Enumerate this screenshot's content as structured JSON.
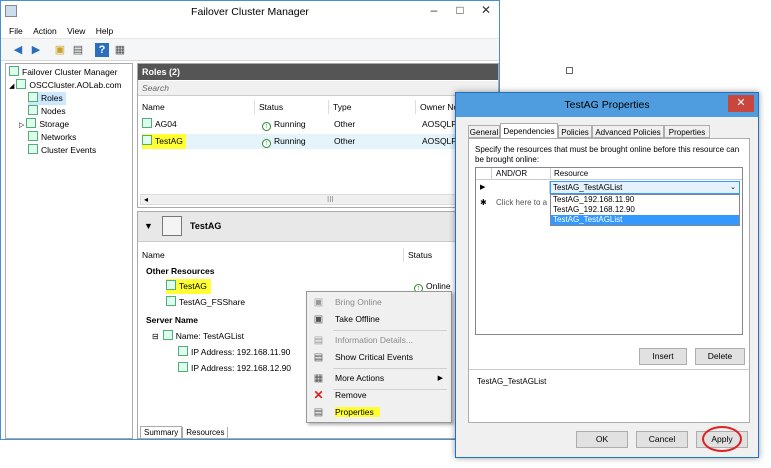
{
  "main_window": {
    "title": "Failover Cluster Manager",
    "menu": [
      "File",
      "Action",
      "View",
      "Help"
    ]
  },
  "tree": {
    "root": "Failover Cluster Manager",
    "cluster": "OSCCluster.AOLab.com",
    "items": [
      "Roles",
      "Nodes",
      "Storage",
      "Networks",
      "Cluster Events"
    ]
  },
  "roles": {
    "header": "Roles (2)",
    "search_placeholder": "Search",
    "columns": [
      "Name",
      "Status",
      "Type",
      "Owner No"
    ],
    "rows": [
      {
        "name": "AG04",
        "status": "Running",
        "type": "Other",
        "owner": "AOSQLP"
      },
      {
        "name": "TestAG",
        "status": "Running",
        "type": "Other",
        "owner": "AOSQLP"
      }
    ],
    "scroll_glyph": "III"
  },
  "detail": {
    "title": "TestAG",
    "columns": [
      "Name",
      "Status"
    ],
    "other_resources_label": "Other Resources",
    "resources": [
      {
        "name": "TestAG",
        "status": "Online"
      },
      {
        "name": "TestAG_FSShare",
        "status": ""
      }
    ],
    "server_name_label": "Server Name",
    "server_entry": "Name: TestAGList",
    "ip_addresses": [
      "IP Address: 192.168.11.90",
      "IP Address: 192.168.12.90"
    ],
    "tabs": [
      "Summary",
      "Resources"
    ]
  },
  "context_menu": {
    "items": [
      {
        "label": "Bring Online",
        "enabled": false
      },
      {
        "label": "Take Offline",
        "enabled": true
      },
      {
        "label": "Information Details...",
        "enabled": false
      },
      {
        "label": "Show Critical Events",
        "enabled": true
      },
      {
        "label": "More Actions",
        "enabled": true
      },
      {
        "label": "Remove",
        "enabled": true
      },
      {
        "label": "Properties",
        "enabled": true
      }
    ]
  },
  "dialog": {
    "title": "TestAG Properties",
    "tabs": [
      "General",
      "Dependencies",
      "Policies",
      "Advanced Policies",
      "Properties"
    ],
    "active_tab": "Dependencies",
    "instruction": "Specify the resources that must be brought online before this resource can be brought online:",
    "grid_columns": [
      "AND/OR",
      "Resource"
    ],
    "selected_value": "TestAG_TestAGList",
    "new_row_placeholder": "Click here to a",
    "dropdown_options": [
      "TestAG_192.168.11.90",
      "TestAG_192.168.12.90",
      "TestAG_TestAGList"
    ],
    "insert_label": "Insert",
    "delete_label": "Delete",
    "expression": "TestAG_TestAGList",
    "ok_label": "OK",
    "cancel_label": "Cancel",
    "apply_label": "Apply"
  },
  "colors": {
    "highlight": "#ffff33",
    "dialog_title": "#4f9ddf",
    "close_button": "#c9463d",
    "apply_circle": "#e02020"
  }
}
